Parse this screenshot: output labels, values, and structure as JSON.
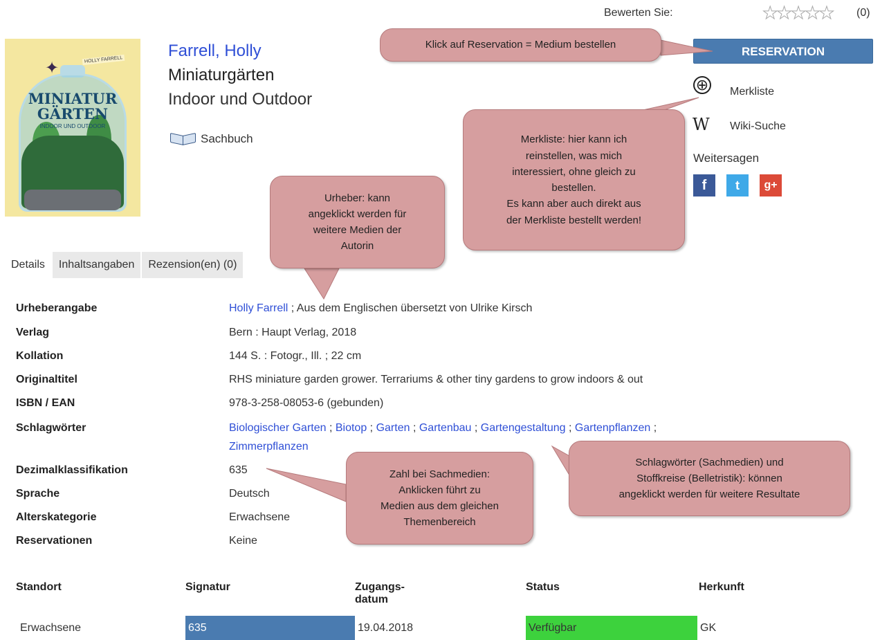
{
  "rating": {
    "label": "Bewerten Sie:",
    "stars": [
      "★",
      "★",
      "★",
      "★",
      "★"
    ],
    "count": "(0)"
  },
  "cover": {
    "author": "HOLLY FARRELL",
    "title_line1": "MINIATUR",
    "title_line2": "GÄRTEN",
    "subtitle": "INDOOR UND OUTDOOR"
  },
  "book": {
    "author": "Farrell, Holly",
    "title": "Miniaturgärten",
    "subtitle": "Indoor und Outdoor",
    "media_type": "Sachbuch"
  },
  "actions": {
    "reserve": "RESERVATION",
    "watchlist_icon": "⊕",
    "watchlist": "Merkliste",
    "wiki_icon": "W",
    "wiki": "Wiki-Suche",
    "share_heading": "Weitersagen",
    "facebook": "f",
    "twitter": "t",
    "googleplus": "g+"
  },
  "tabs": [
    "Details",
    "Inhaltsangaben",
    "Rezension(en) (0)"
  ],
  "details": {
    "urheber_label": "Urheberangabe",
    "urheber_link": "Holly Farrell",
    "urheber_rest": " ; Aus dem Englischen übersetzt von Ulrike Kirsch",
    "verlag_label": "Verlag",
    "verlag": "Bern : Haupt Verlag, 2018",
    "kollation_label": "Kollation",
    "kollation": "144 S. : Fotogr., Ill. ; 22 cm",
    "original_label": "Originaltitel",
    "original": "RHS miniature garden grower. Terrariums & other tiny gardens to grow indoors & out",
    "isbn_label": "ISBN / EAN",
    "isbn": "978-3-258-08053-6 (gebunden)",
    "schlag_label": "Schlagwörter",
    "keywords": [
      "Biologischer Garten",
      "Biotop",
      "Garten",
      "Gartenbau",
      "Gartengestaltung",
      "Gartenpflanzen",
      "Zimmerpflanzen"
    ],
    "keyword_sep": " ; ",
    "dezimal_label": "Dezimalklassifikation",
    "dezimal": "635",
    "sprache_label": "Sprache",
    "sprache": "Deutsch",
    "alter_label": "Alterskategorie",
    "alter": "Erwachsene",
    "reserv_label": "Reservationen",
    "reserv": "Keine"
  },
  "holdings": {
    "headers": {
      "standort": "Standort",
      "signatur": "Signatur",
      "zugang1": "Zugangs-",
      "zugang2": "datum",
      "status": "Status",
      "herkunft": "Herkunft"
    },
    "row": {
      "standort": "Erwachsene",
      "signatur": "635",
      "zugang": "19.04.2018",
      "status": "Verfügbar",
      "herkunft": "GK"
    }
  },
  "callouts": {
    "reservation": "Klick auf Reservation = Medium bestellen",
    "merkliste": "Merkliste: hier kann ich\nreinstellen, was mich\ninteressiert, ohne gleich zu\nbestellen.\nEs kann aber auch direkt aus\nder Merkliste bestellt werden!",
    "urheber": "Urheber: kann\nangeklickt werden für\nweitere Medien der\nAutorin",
    "zahl": "Zahl bei Sachmedien:\nAnklicken führt zu\nMedien aus dem gleichen\nThemenbereich",
    "schlagwoerter": "Schlagwörter (Sachmedien) und\nStoffkreise (Belletristik): können\nangeklickt werden für weitere Resultate"
  },
  "colors": {
    "link": "#2f4fd6",
    "button": "#4a7bb0",
    "available": "#3dd23d",
    "callout": "#d69e9f"
  }
}
